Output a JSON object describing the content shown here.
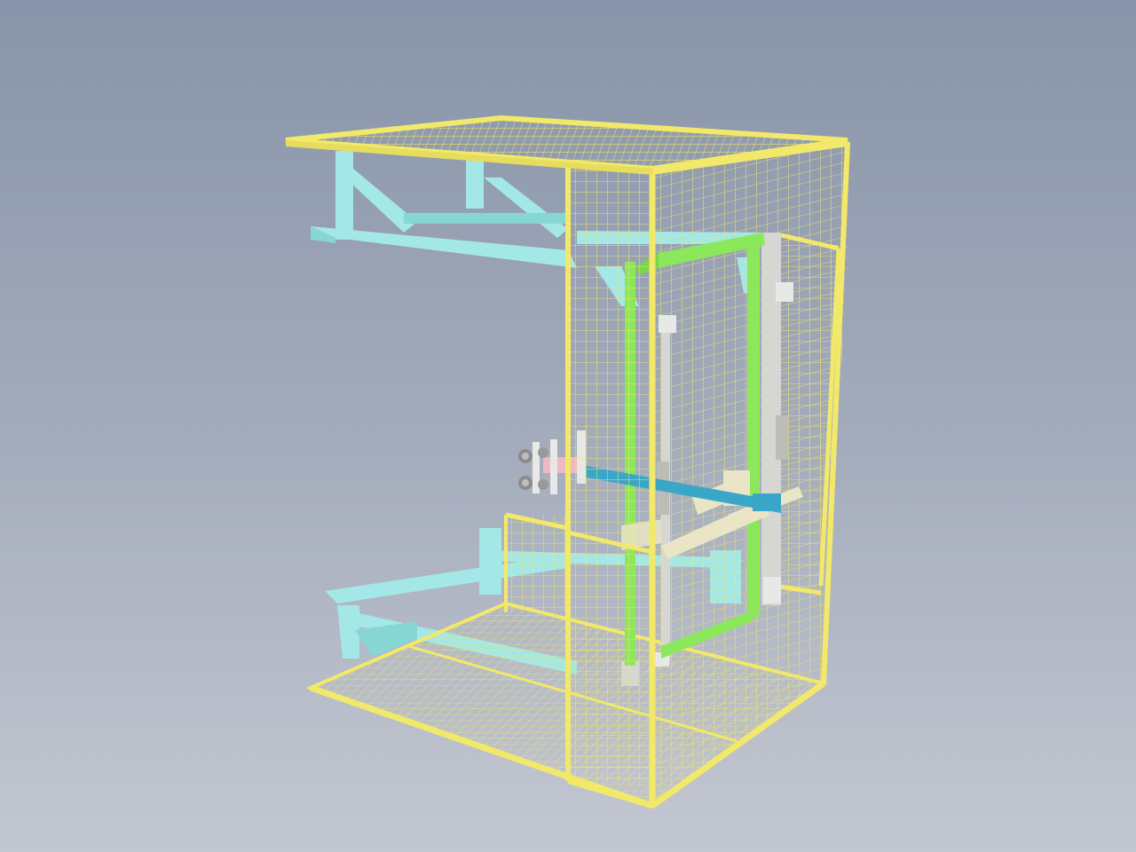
{
  "view": {
    "background_top": "#8894a9",
    "background_bottom": "#c3c7d1"
  },
  "model": {
    "description_visible": false,
    "colors": {
      "fence_frame": "#f2e96a",
      "fence_mesh": "#eee36a",
      "cyan_frame": "#a3e8e6",
      "cyan_frame_shade": "#86d6d3",
      "green_frame": "#8be85a",
      "rail_gray": "#d6d6d3",
      "rail_shade": "#bdbdb8",
      "cream_arm": "#e9e5c6",
      "blue_rod": "#3aa7c8",
      "pink_part": "#f0b7c6",
      "suction_cup": "#8c8c8c"
    }
  }
}
